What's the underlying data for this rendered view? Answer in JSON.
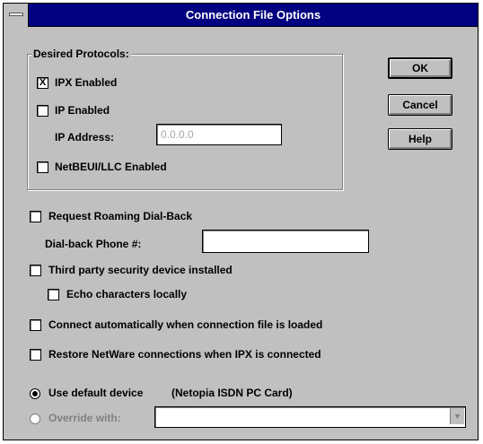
{
  "window": {
    "title": "Connection File Options"
  },
  "protocols": {
    "group_label": "Desired Protocols:",
    "ipx": {
      "label": "IPX Enabled",
      "checked": true
    },
    "ip": {
      "label": "IP Enabled",
      "checked": false
    },
    "ip_address": {
      "label": "IP Address:",
      "value": "0.0.0.0"
    },
    "netbeui": {
      "label": "NetBEUI/LLC Enabled",
      "checked": false
    }
  },
  "buttons": {
    "ok": "OK",
    "cancel": "Cancel",
    "help": "Help"
  },
  "options": {
    "roaming": {
      "label": "Request Roaming Dial-Back",
      "checked": false
    },
    "dialback_phone": {
      "label": "Dial-back Phone #:",
      "value": ""
    },
    "third_party": {
      "label": "Third party security device installed",
      "checked": false
    },
    "echo": {
      "label": "Echo characters locally",
      "checked": false
    },
    "auto_connect": {
      "label": "Connect automatically when connection file is loaded",
      "checked": false
    },
    "restore": {
      "label": "Restore NetWare connections when IPX is connected",
      "checked": false
    }
  },
  "device": {
    "use_default": {
      "label": "Use default device",
      "selected": true
    },
    "default_device_name": "(Netopia ISDN PC Card)",
    "override": {
      "label": "Override with:",
      "selected": false,
      "value": ""
    }
  },
  "icons": {
    "checkmark": "X",
    "dropdown_arrow": "▼"
  }
}
